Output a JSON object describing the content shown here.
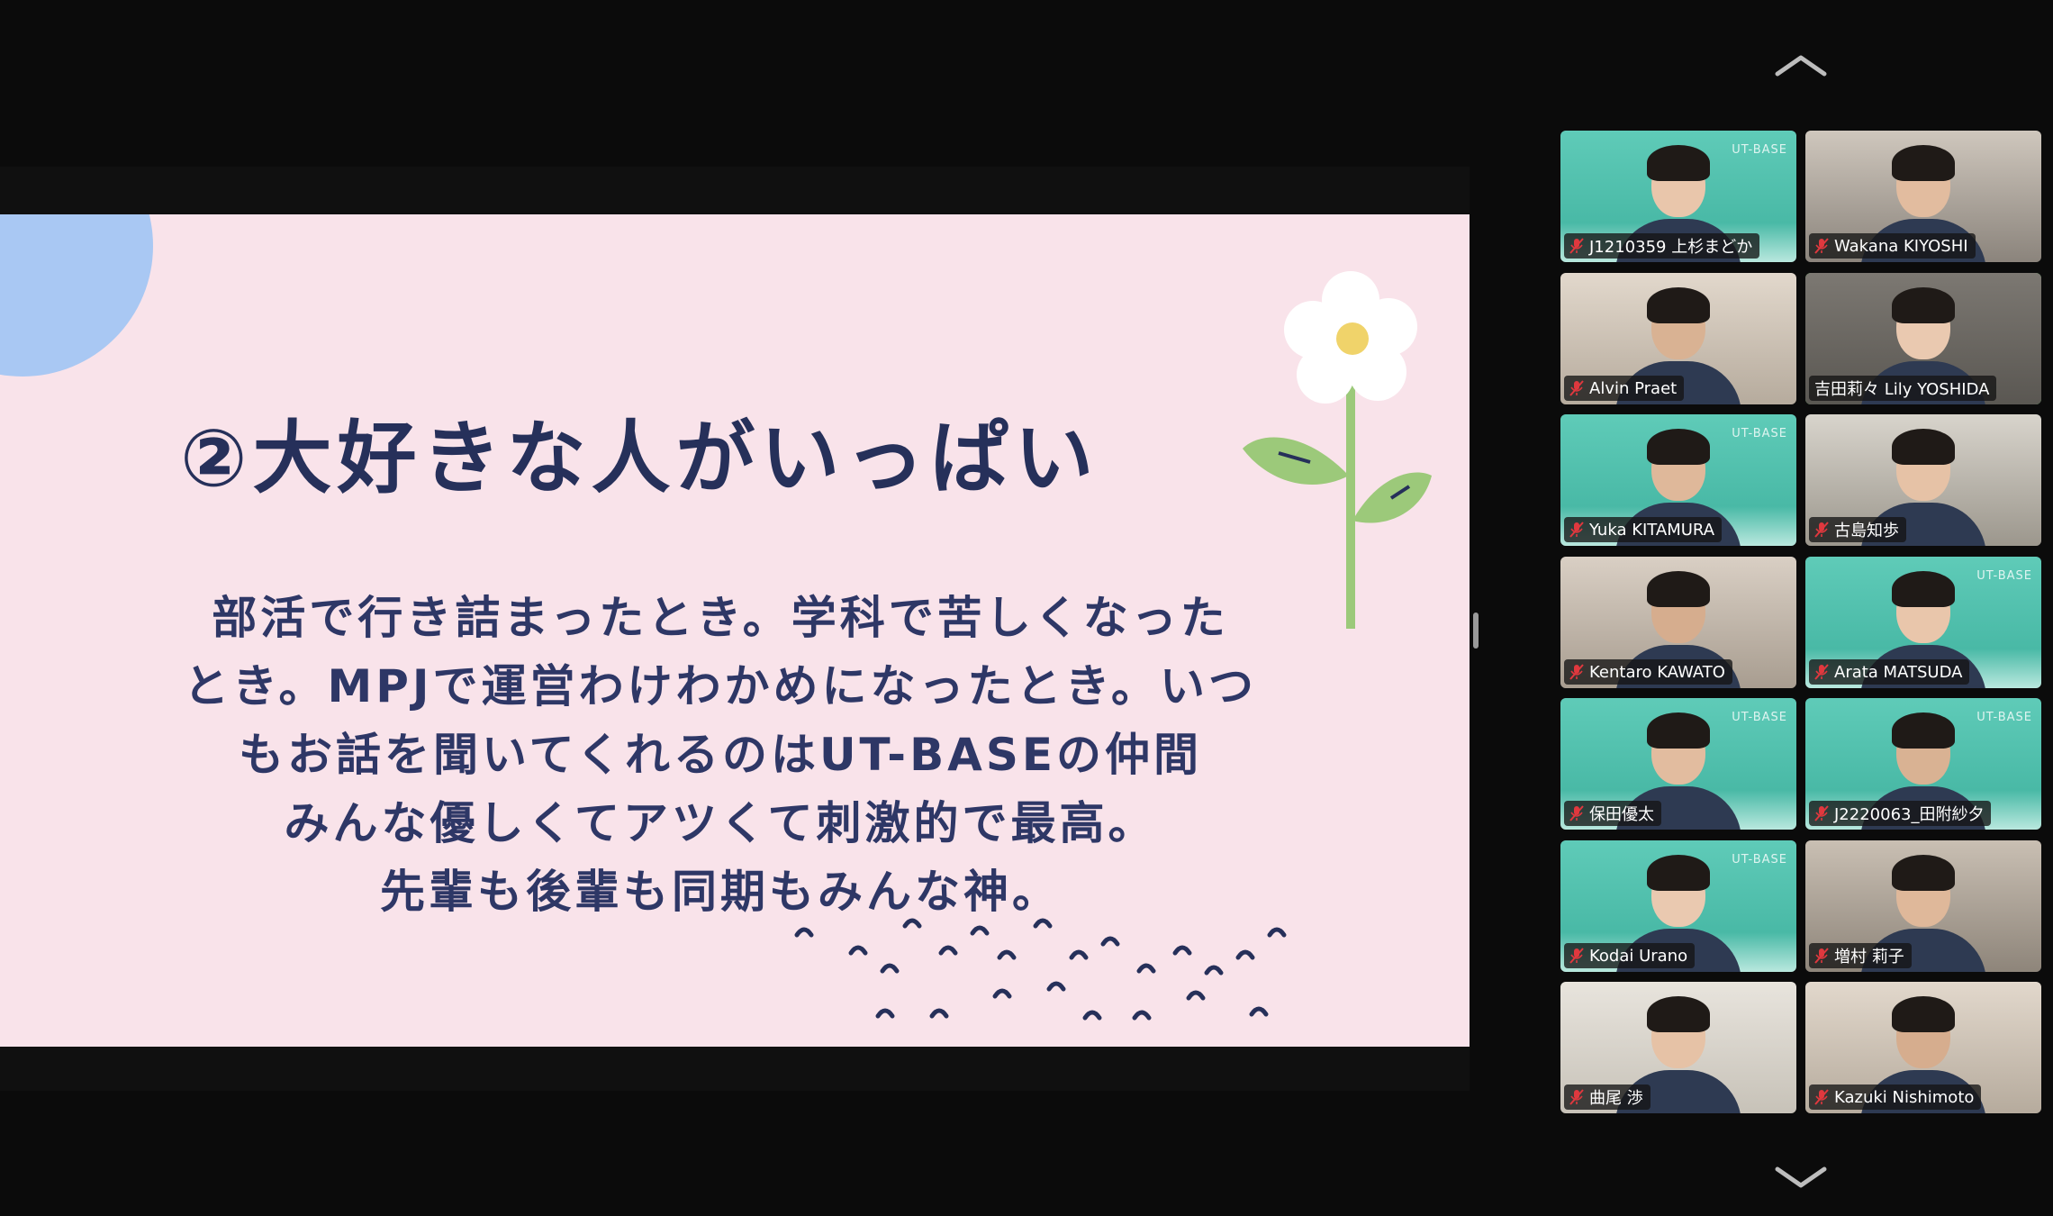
{
  "slide": {
    "title": "②大好きな人がいっぱい",
    "body": [
      "部活で行き詰まったとき。学科で苦しくなった",
      "とき。MPJで運営わけわかめになったとき。いつ",
      "もお話を聞いてくれるのはUT-BASEの仲間",
      "みんな優しくてアツくて刺激的で最高。",
      "先輩も後輩も同期もみんな神。"
    ]
  },
  "gallery": {
    "watermark": "UT-BASE",
    "participants": [
      {
        "name": "J1210359 上杉まどか",
        "muted": true,
        "active": false,
        "bg": "teal",
        "watermark": true
      },
      {
        "name": "Wakana KIYOSHI",
        "muted": true,
        "active": false,
        "bg": "room1",
        "watermark": false
      },
      {
        "name": "Alvin Praet",
        "muted": true,
        "active": false,
        "bg": "room2",
        "watermark": false
      },
      {
        "name": "吉田莉々 Lily YOSHIDA",
        "muted": false,
        "active": true,
        "bg": "room4",
        "watermark": false
      },
      {
        "name": "Yuka KITAMURA",
        "muted": true,
        "active": false,
        "bg": "teal",
        "watermark": true
      },
      {
        "name": "古島知歩",
        "muted": true,
        "active": false,
        "bg": "room3",
        "watermark": false
      },
      {
        "name": "Kentaro KAWATO",
        "muted": true,
        "active": false,
        "bg": "room5",
        "watermark": false
      },
      {
        "name": "Arata MATSUDA",
        "muted": true,
        "active": false,
        "bg": "teal",
        "watermark": true
      },
      {
        "name": "保田優太",
        "muted": true,
        "active": false,
        "bg": "teal",
        "watermark": true
      },
      {
        "name": "J2220063_田附紗夕",
        "muted": true,
        "active": false,
        "bg": "teal",
        "watermark": true
      },
      {
        "name": "Kodai Urano",
        "muted": true,
        "active": false,
        "bg": "teal",
        "watermark": true
      },
      {
        "name": "増村 莉子",
        "muted": true,
        "active": false,
        "bg": "room6",
        "watermark": false
      },
      {
        "name": "曲尾 渉",
        "muted": true,
        "active": false,
        "bg": "room7",
        "watermark": false
      },
      {
        "name": "Kazuki Nishimoto",
        "muted": true,
        "active": false,
        "bg": "room2",
        "watermark": false
      }
    ]
  },
  "icons": {
    "scroll_up": "chevron-up-icon",
    "scroll_down": "chevron-down-icon",
    "mic_off": "mic-off-icon"
  },
  "colors": {
    "slide_bg": "#f9e3ea",
    "slide_text": "#2e3766",
    "active_speaker": "#46c84a",
    "mute_red": "#e0383e"
  }
}
